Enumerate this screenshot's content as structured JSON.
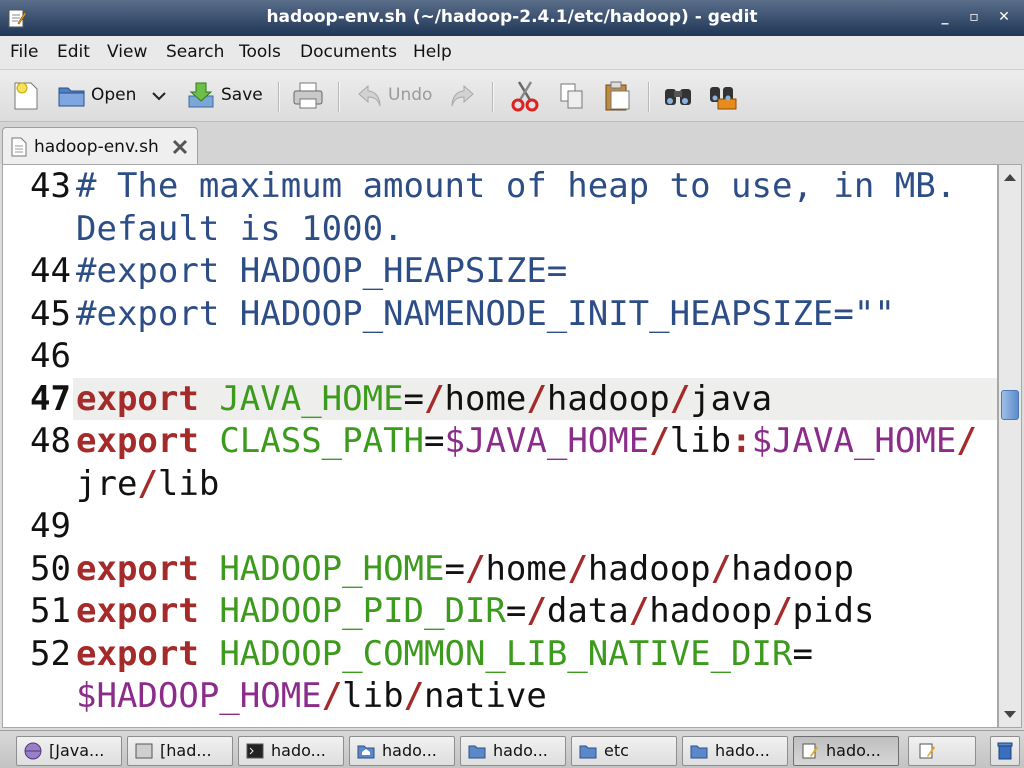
{
  "window": {
    "title": "hadoop-env.sh (~/hadoop-2.4.1/etc/hadoop) - gedit",
    "minimize": "_",
    "maximize": "▫",
    "close": "✕"
  },
  "menu": [
    "File",
    "Edit",
    "View",
    "Search",
    "Tools",
    "Documents",
    "Help"
  ],
  "toolbar": {
    "open_label": "Open",
    "save_label": "Save",
    "undo_label": "Undo"
  },
  "tab": {
    "label": "hadoop-env.sh"
  },
  "editor": {
    "line_numbers": [
      "43",
      "44",
      "45",
      "46",
      "47",
      "48",
      "49",
      "50",
      "51",
      "52"
    ],
    "lines": {
      "l43a": "# The maximum amount of heap to use, in MB.",
      "l43b": "Default is 1000.",
      "l44": "#export HADOOP_HEAPSIZE=",
      "l45": "#export HADOOP_NAMENODE_INIT_HEAPSIZE=\"\""
    },
    "tokens": {
      "export": "export",
      "java_home": "JAVA_HOME",
      "class_path": "CLASS_PATH",
      "hadoop_home": "HADOOP_HOME",
      "hadoop_pid_dir": "HADOOP_PID_DIR",
      "hadoop_common_lib_native_dir": "HADOOP_COMMON_LIB_NATIVE_DIR",
      "eq": "=",
      "slash": "/",
      "colon": ":",
      "home": "home",
      "hadoop": "hadoop",
      "java": "java",
      "lib": "lib",
      "jre": "jre",
      "data": "data",
      "pids": "pids",
      "native": "native",
      "dollar_java_home": "$JAVA_HOME",
      "dollar_hadoop_home": "$HADOOP_HOME"
    }
  },
  "taskbar": [
    "[Java...",
    "[had...",
    "hado...",
    "hado...",
    "hado...",
    "etc",
    "hado...",
    "hado..."
  ],
  "colors": {
    "comment": "#2d4d86",
    "keyword": "#a52a2a",
    "variable": "#3c9a1c",
    "dollar_var": "#8b2c8b"
  }
}
